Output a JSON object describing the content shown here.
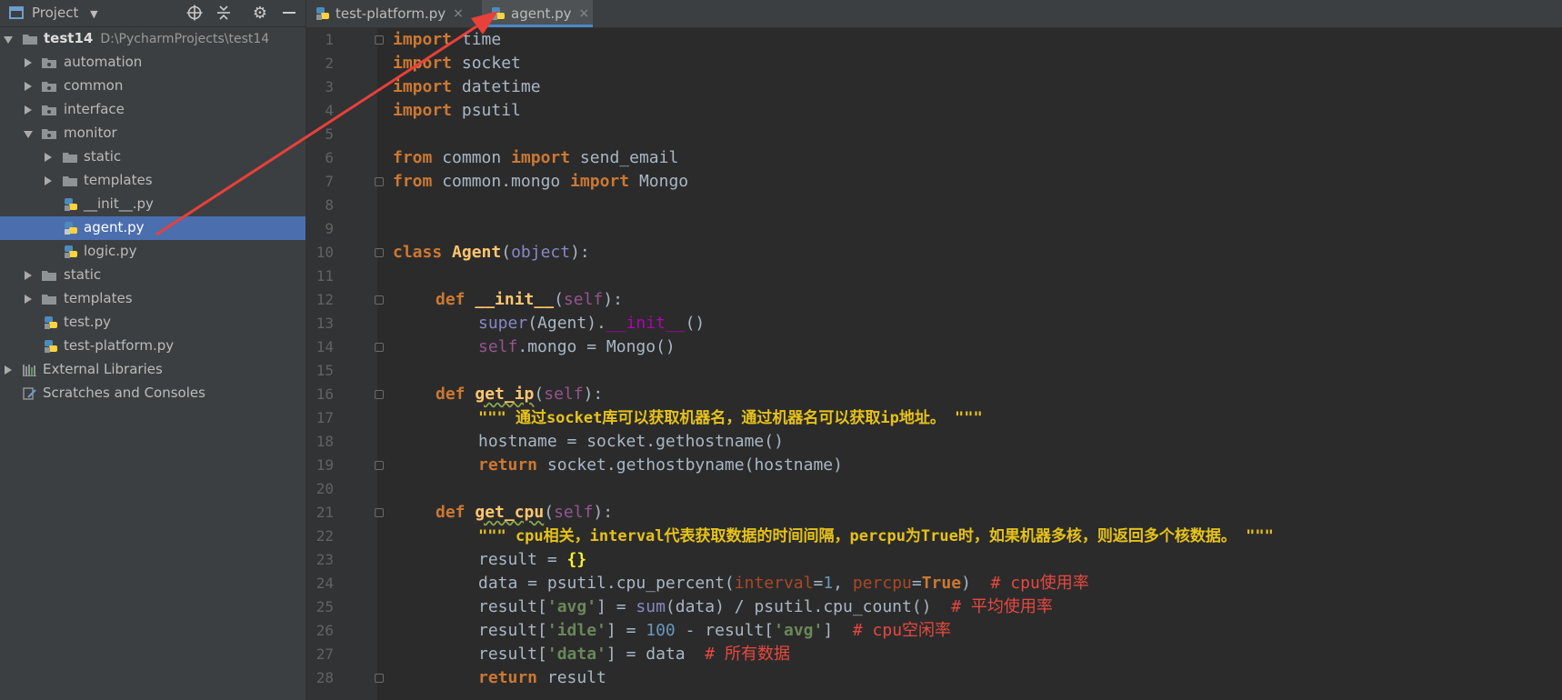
{
  "sidebar": {
    "title": "Project",
    "items": [
      {
        "label": "test14",
        "path": "D:\\PycharmProjects\\test14"
      },
      {
        "label": "automation"
      },
      {
        "label": "common"
      },
      {
        "label": "interface"
      },
      {
        "label": "monitor"
      },
      {
        "label": "static"
      },
      {
        "label": "templates"
      },
      {
        "label": "__init__.py"
      },
      {
        "label": "agent.py"
      },
      {
        "label": "logic.py"
      },
      {
        "label": "static"
      },
      {
        "label": "templates"
      },
      {
        "label": "test.py"
      },
      {
        "label": "test-platform.py"
      },
      {
        "label": "External Libraries"
      },
      {
        "label": "Scratches and Consoles"
      }
    ]
  },
  "tabs": [
    {
      "label": "test-platform.py",
      "close": "×"
    },
    {
      "label": "agent.py",
      "close": "×"
    }
  ],
  "editor": {
    "line_numbers": [
      "1",
      "2",
      "3",
      "4",
      "5",
      "6",
      "7",
      "8",
      "9",
      "10",
      "11",
      "12",
      "13",
      "14",
      "15",
      "16",
      "17",
      "18",
      "19",
      "20",
      "21",
      "22",
      "23",
      "24",
      "25",
      "26",
      "27",
      "28"
    ],
    "code": {
      "l1_kw": "import",
      "l1_mod": " time",
      "l2_kw": "import",
      "l2_mod": " socket",
      "l3_kw": "import",
      "l3_mod": " datetime",
      "l4_kw": "import",
      "l4_mod": " psutil",
      "l6_kw1": "from",
      "l6_mod": " common ",
      "l6_kw2": "import",
      "l6_name": " send_email",
      "l7_kw1": "from",
      "l7_mod": " common.mongo ",
      "l7_kw2": "import",
      "l7_name": " Mongo",
      "l10_kw": "class",
      "l10_name": " Agent",
      "l10_p1": "(",
      "l10_base": "object",
      "l10_p2": "):",
      "l12_kw": "def",
      "l12_name": " __init__",
      "l12_p1": "(",
      "l12_self": "self",
      "l12_p2": "):",
      "l13_builtin": "super",
      "l13_rest": "(Agent).",
      "l13_dunder": "__init__",
      "l13_end": "()",
      "l14_self": "self",
      "l14_rest": ".mongo = Mongo()",
      "l16_kw": "def",
      "l16_sp": " ",
      "l16_name": "get_ip",
      "l16_p1": "(",
      "l16_self": "self",
      "l16_p2": "):",
      "l17_doc": "\"\"\" 通过socket库可以获取机器名，通过机器名可以获取ip地址。 \"\"\"",
      "l18_code": "hostname = socket.gethostname()",
      "l19_kw": "return",
      "l19_rest": " socket.gethostbyname(hostname)",
      "l21_kw": "def",
      "l21_sp": " ",
      "l21_name": "get_cpu",
      "l21_p1": "(",
      "l21_self": "self",
      "l21_p2": "):",
      "l22_doc": "\"\"\" cpu相关，interval代表获取数据的时间间隔，percpu为True时，如果机器多核，则返回多个核数据。 \"\"\"",
      "l23_code": "result = ",
      "l23_brace": "{}",
      "l24_a": "data = psutil.cpu_percent(",
      "l24_p1": "interval",
      "l24_eq1": "=",
      "l24_n1": "1",
      "l24_c": ", ",
      "l24_p2": "percpu",
      "l24_eq2": "=",
      "l24_true": "True",
      "l24_end": ")  ",
      "l24_cmt": "# cpu使用率",
      "l25_a": "result[",
      "l25_s": "'avg'",
      "l25_b": "] = ",
      "l25_bi": "sum",
      "l25_c": "(data) / psutil.cpu_count()  ",
      "l25_cmt": "# 平均使用率",
      "l26_a": "result[",
      "l26_s": "'idle'",
      "l26_b": "] = ",
      "l26_n": "100",
      "l26_c": " - result[",
      "l26_s2": "'avg'",
      "l26_d": "]  ",
      "l26_cmt": "# cpu空闲率",
      "l27_a": "result[",
      "l27_s": "'data'",
      "l27_b": "] = data  ",
      "l27_cmt": "# 所有数据",
      "l28_kw": "return",
      "l28_rest": " result"
    }
  },
  "colors": {
    "keyword": "#cc7832",
    "function": "#ffc66d",
    "docstring": "#e6c21a",
    "string": "#6a8759",
    "comment": "#e8483f",
    "selection": "#4b6eaf",
    "annotation_arrow": "#e8403a"
  },
  "icons": {
    "project": "project-window-icon",
    "locate": "crosshair-icon",
    "collapse": "collapse-all-icon",
    "settings": "gear-icon",
    "hide": "minimize-icon",
    "folder": "folder-icon",
    "python": "python-file-icon",
    "libraries": "library-icon",
    "scratches": "scratches-icon"
  }
}
